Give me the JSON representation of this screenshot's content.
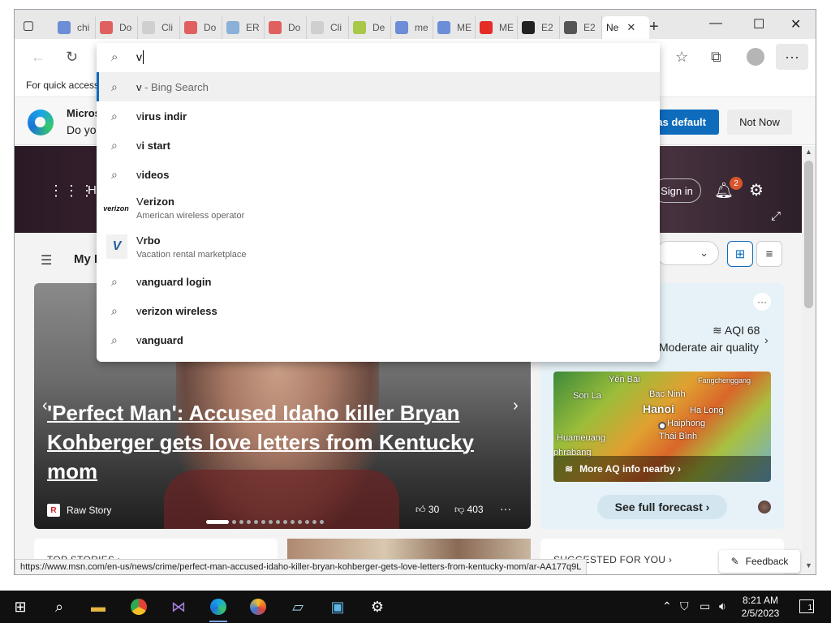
{
  "browser": {
    "tabs": [
      {
        "title": "chi",
        "icon": "search-icon",
        "color": "#6b8ed6"
      },
      {
        "title": "Do",
        "icon": "doc-icon",
        "color": "#e06060"
      },
      {
        "title": "Cli",
        "icon": "page-icon",
        "color": "#cfcfcf"
      },
      {
        "title": "Do",
        "icon": "doc-icon",
        "color": "#e06060"
      },
      {
        "title": "ER",
        "icon": "page-icon",
        "color": "#8ab0d8"
      },
      {
        "title": "Do",
        "icon": "doc-icon",
        "color": "#e06060"
      },
      {
        "title": "Cli",
        "icon": "page-icon",
        "color": "#cfcfcf"
      },
      {
        "title": "De",
        "icon": "leaf-icon",
        "color": "#a8c84a"
      },
      {
        "title": "me",
        "icon": "search-icon",
        "color": "#6b8ed6"
      },
      {
        "title": "ME",
        "icon": "search-icon",
        "color": "#6b8ed6"
      },
      {
        "title": "ME",
        "icon": "youtube-icon",
        "color": "#e52d27"
      },
      {
        "title": "E2",
        "icon": "github-icon",
        "color": "#222222"
      },
      {
        "title": "E2",
        "icon": "github-icon",
        "color": "#555555"
      }
    ],
    "active_tab": "Ne",
    "favorites_text": "For quick access"
  },
  "omnibox": {
    "typed": "v",
    "suggestions": [
      {
        "prefix": "v",
        "rest": " - Bing Search",
        "kind": "search",
        "selected": true
      },
      {
        "prefix": "v",
        "rest": "irus indir",
        "kind": "search"
      },
      {
        "prefix": "v",
        "rest": "i start",
        "kind": "search"
      },
      {
        "prefix": "v",
        "rest": "ideos",
        "kind": "search"
      },
      {
        "prefix": "V",
        "rest": "erizon",
        "sub": "American wireless operator",
        "kind": "entity",
        "logo": "verizon"
      },
      {
        "prefix": "V",
        "rest": "rbo",
        "sub": "Vacation rental marketplace",
        "kind": "entity",
        "logo": "V"
      },
      {
        "prefix": "v",
        "rest": "anguard login",
        "kind": "search"
      },
      {
        "prefix": "v",
        "rest": "erizon wireless",
        "kind": "search"
      },
      {
        "prefix": "v",
        "rest": "anguard",
        "kind": "search"
      }
    ]
  },
  "banner": {
    "title": "Micros",
    "body": "Do yo",
    "default_button": "t as default",
    "not_now": "Not Now"
  },
  "msn": {
    "hero_letter": "H",
    "sign_in": "Sign in",
    "notification_count": "2",
    "my_feed": "My I"
  },
  "news": {
    "headline": "'Perfect Man': Accused Idaho killer Bryan Kohberger gets love letters from Kentucky mom",
    "source": "Raw Story",
    "source_logo": "R",
    "likes": "30",
    "dislikes": "403",
    "carousel_count": 14,
    "carousel_index": 0
  },
  "weather": {
    "aqi": "AQI 68",
    "aq_desc": "Moderate air quality",
    "map_labels": [
      "Yên Bái",
      "Fangchenggang",
      "Son La",
      "Bac Ninh",
      "Hanoi",
      "Ha Long",
      "Haiphong",
      "Thái Bình",
      "Huameuang",
      "phrabang"
    ],
    "aq_link": "More AQ info nearby",
    "forecast": "See full forecast"
  },
  "sections": {
    "top_stories": "TOP STORIES",
    "suggested": "SUGGESTED FOR YOU"
  },
  "status_url": "https://www.msn.com/en-us/news/crime/perfect-man-accused-idaho-killer-bryan-kohberger-gets-love-letters-from-kentucky-mom/ar-AA177q9L",
  "feedback": "Feedback",
  "taskbar": {
    "time": "8:21 AM",
    "date": "2/5/2023",
    "notification_count": "1"
  }
}
